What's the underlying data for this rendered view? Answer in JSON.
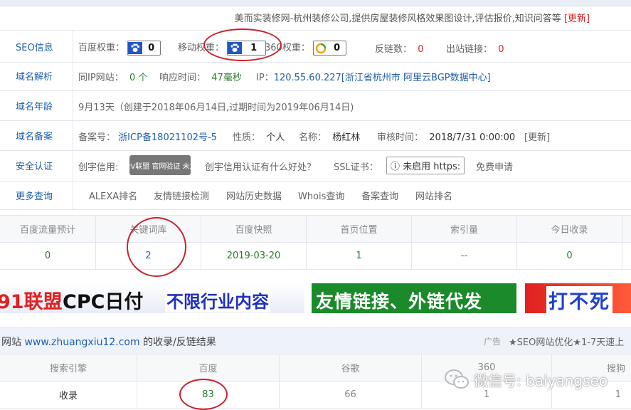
{
  "header": {
    "site_description": "美而实装修网-杭州装修公司,提供房屋装修风格效果图设计,评估报价,知识问答等",
    "update_link": "[更新]"
  },
  "seo": {
    "label": "SEO信息",
    "baidu_weight_label": "百度权重：",
    "baidu_weight": "0",
    "mobile_weight_label": "移动权重：",
    "mobile_weight": "1",
    "weight360_label": "360权重：",
    "weight360": "0",
    "backlinks_label": "反链数：",
    "backlinks": "0",
    "outlinks_label": "出站链接：",
    "outlinks": "0"
  },
  "dns": {
    "label": "域名解析",
    "sameip_label": "同IP网站：",
    "sameip": "0 个",
    "response_label": "响应时间：",
    "response": "47毫秒",
    "ip_label": "IP：",
    "ip": "120.55.60.227[浙江省杭州市 阿里云BGP数据中心]"
  },
  "age": {
    "label": "域名年龄",
    "text": "9月13天（创建于2018年06月14日,过期时间为2019年06月14日)"
  },
  "icp": {
    "label": "域名备案",
    "no_label": "备案号：",
    "no": "浙ICP备18021102号-5",
    "nature_label": "性质：",
    "nature": "个人",
    "name_label": "名称：",
    "name": "杨红林",
    "time_label": "审核时间：",
    "time": "2018/7/31 0:00:00",
    "update": "[更新]"
  },
  "security": {
    "label": "安全认证",
    "credit_label": "创宇信用:",
    "seal_text": "安全V联盟 官网验证 未加入",
    "credit_link": "创宇信用认证有什么好处？",
    "ssl_label": "SSL证书：",
    "ssl_value": "ⓘ 未启用 https:",
    "free_apply": "免费申请"
  },
  "more": {
    "label": "更多查询",
    "links": [
      "ALEXA排名",
      "友情链接检测",
      "网站历史数据",
      "Whois查询",
      "备案查询",
      "网站排名"
    ]
  },
  "stats": {
    "headers": [
      "百度流量预计",
      "关键词库",
      "百度快照",
      "首页位置",
      "索引量",
      "今日收录"
    ],
    "values": [
      "0",
      "2",
      "2019-03-20",
      "1",
      "--",
      "0"
    ]
  },
  "banners": {
    "b1a": "91联盟",
    "b1b": "CPC日付",
    "b1c": "不限行业内容",
    "b2": "友情链接、外链代发",
    "b3": "打不死"
  },
  "index_section": {
    "title_prefix": "网站",
    "domain": "www.zhuangxiu12.com",
    "title_suffix": "的收录/反链结果",
    "ad_label": "广告",
    "ad_text": "★SEO网站优化★1-7天速上",
    "headers": [
      "搜索引擎",
      "百度",
      "谷歌",
      "360",
      "搜狗"
    ],
    "row_label": "收录",
    "values": [
      "83",
      "66",
      "1",
      "1"
    ]
  },
  "watermark": "微信号: baiyangseo"
}
